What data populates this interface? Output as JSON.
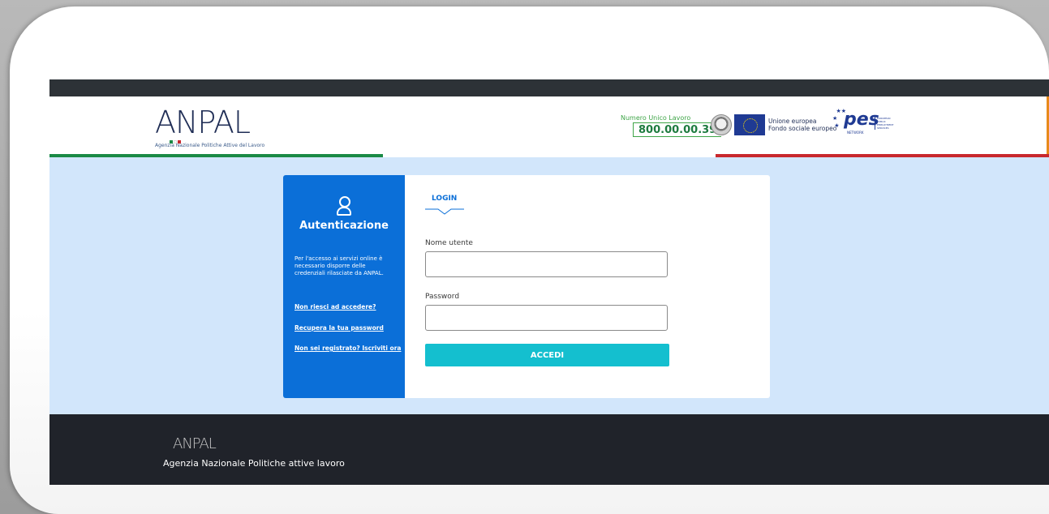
{
  "brand": {
    "logo_text": "ANPAL",
    "subtitle": "Agenzia Nazionale Politiche Attive del Lavoro"
  },
  "header": {
    "hotline_label": "Numero Unico Lavoro",
    "hotline_number": "800.00.00.39",
    "eu_line1": "Unione europea",
    "eu_line2": "Fondo sociale europeo",
    "pes_logo": "pes",
    "pes_sub": "NETWORK",
    "pes_side": "EUROPEAN PUBLIC EMPLOYMENT SERVICES",
    "tricolor": [
      "#1a8a45",
      "#ffffff",
      "#c8282d"
    ]
  },
  "auth_panel": {
    "icon": "user-icon",
    "title": "Autenticazione",
    "description": "Per l'accesso ai servizi online è necessario disporre delle credenziali rilasciate da ANPAL.",
    "links": [
      "Non riesci ad accedere?",
      "Recupera la tua password",
      "Non sei registrato? Iscriviti ora"
    ]
  },
  "login": {
    "tab": "LOGIN",
    "username_label": "Nome utente",
    "username_value": "",
    "password_label": "Password",
    "password_value": "",
    "submit": "ACCEDI"
  },
  "footer": {
    "logo_text": "ANPAL",
    "tagline": "Agenzia Nazionale Politiche attive lavoro"
  },
  "colors": {
    "primary_blue": "#0b6fd8",
    "button_teal": "#14bfcf",
    "page_bg": "#d2e6fb",
    "dark": "#20232a"
  }
}
